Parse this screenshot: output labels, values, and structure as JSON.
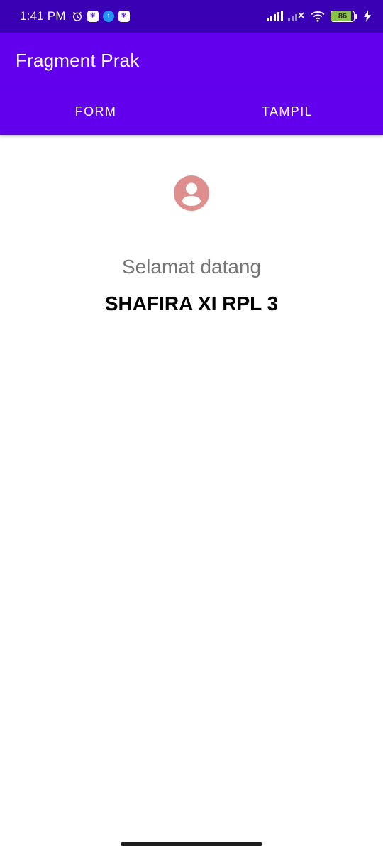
{
  "status_bar": {
    "time": "1:41 PM",
    "battery_percent": "86",
    "battery_level": 0.86,
    "icons": [
      "alarm-icon",
      "app-notification-icon",
      "upload-icon",
      "app-notification-icon",
      "signal-icon",
      "signal-no-service-icon",
      "wifi-icon",
      "battery-icon",
      "charging-icon"
    ]
  },
  "app_bar": {
    "title": "Fragment Prak"
  },
  "tabs": [
    {
      "label": "FORM"
    },
    {
      "label": "TAMPIL"
    }
  ],
  "main": {
    "avatar_icon": "account-circle-icon",
    "welcome_text": "Selamat datang",
    "user_name": "SHAFIRA XI RPL 3"
  },
  "colors": {
    "status_bar": "#3a00b3",
    "primary": "#6200ee",
    "avatar": "#df8e8e",
    "welcome_text": "#757575"
  }
}
